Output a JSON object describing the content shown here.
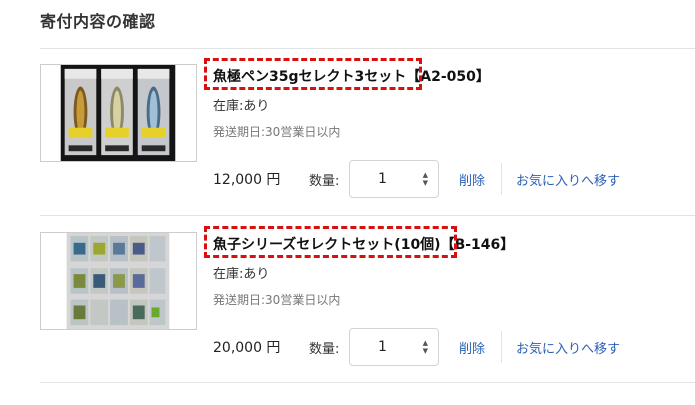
{
  "page": {
    "title": "寄付内容の確認"
  },
  "items": [
    {
      "name": "魚極ペン35gセレクト3セット【A2-050】",
      "stock": "在庫:あり",
      "ship": "発送期日:30営業日以内",
      "price": "12,000 円",
      "qty_label": "数量:",
      "qty_value": "1",
      "delete_label": "削除",
      "fav_label": "お気に入りへ移す",
      "image_icon": "lure-pack-photo"
    },
    {
      "name": "魚子シリーズセレクトセット(10個)【B-146】",
      "stock": "在庫:あり",
      "ship": "発送期日:30営業日以内",
      "price": "20,000 円",
      "qty_label": "数量:",
      "qty_value": "1",
      "delete_label": "削除",
      "fav_label": "お気に入りへ移す",
      "image_icon": "lure-set-photo"
    }
  ],
  "colors": {
    "link": "#2b61b5",
    "highlight": "#d81010",
    "divider": "#e3e3e3"
  }
}
